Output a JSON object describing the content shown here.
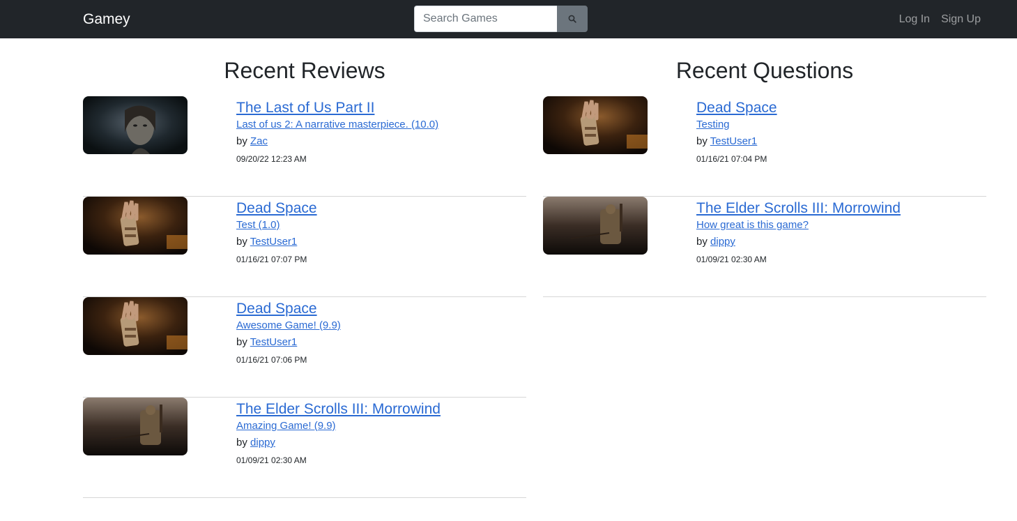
{
  "nav": {
    "brand": "Gamey",
    "search_placeholder": "Search Games",
    "search_icon": "search-icon",
    "login": "Log In",
    "signup": "Sign Up"
  },
  "reviews": {
    "title": "Recent Reviews",
    "items": [
      {
        "game": "The Last of Us Part II",
        "summary": "Last of us 2: A narrative masterpiece. (10.0)",
        "by": "by",
        "user": "Zac",
        "date": "09/20/22 12:23 AM",
        "thumb": "tlou2"
      },
      {
        "game": "Dead Space",
        "summary": "Test (1.0)",
        "by": "by",
        "user": "TestUser1",
        "date": "01/16/21 07:07 PM",
        "thumb": "deadspace"
      },
      {
        "game": "Dead Space",
        "summary": "Awesome Game! (9.9)",
        "by": "by",
        "user": "TestUser1",
        "date": "01/16/21 07:06 PM",
        "thumb": "deadspace"
      },
      {
        "game": "The Elder Scrolls III: Morrowind",
        "summary": "Amazing Game! (9.9)",
        "by": "by",
        "user": "dippy",
        "date": "01/09/21 02:30 AM",
        "thumb": "morrowind"
      }
    ]
  },
  "questions": {
    "title": "Recent Questions",
    "items": [
      {
        "game": "Dead Space",
        "summary": "Testing",
        "by": "by",
        "user": "TestUser1",
        "date": "01/16/21 07:04 PM",
        "thumb": "deadspace"
      },
      {
        "game": "The Elder Scrolls III: Morrowind",
        "summary": "How great is this game?",
        "by": "by",
        "user": "dippy",
        "date": "01/09/21 02:30 AM",
        "thumb": "morrowind"
      }
    ]
  },
  "colors": {
    "navbar": "#212529",
    "link": "#2a6ad3",
    "search_button": "#6c757d"
  }
}
